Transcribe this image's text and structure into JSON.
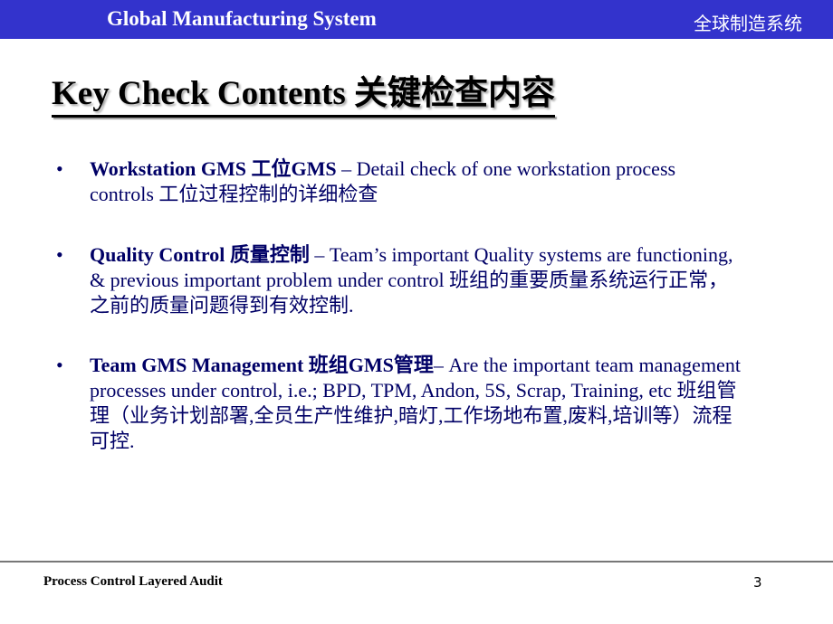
{
  "header": {
    "title": "Global Manufacturing System",
    "title_cn": "全球制造系统",
    "background_color": "#3333cc"
  },
  "slide": {
    "title": "Key Check Contents 关键检查内容",
    "bullet_symbol": "•",
    "bullets": [
      {
        "lead": "Workstation GMS 工位GMS",
        "rest": " – Detail check of one workstation process controls 工位过程控制的详细检查"
      },
      {
        "lead": "Quality Control 质量控制",
        "rest": " – Team’s important Quality systems are functioning, & previous important problem under control 班组的重要质量系统运行正常，之前的质量问题得到有效控制."
      },
      {
        "lead": "Team GMS Management 班组GMS管理",
        "rest": "– Are the important team management processes under control,  i.e.; BPD, TPM, Andon, 5S, Scrap, Training,  etc 班组管理（业务计划部署,全员生产性维护,暗灯,工作场地布置,废料,培训等）流程可控."
      }
    ],
    "text_color": "#000066"
  },
  "footer": {
    "label": "Process Control Layered Audit",
    "page_number": "3"
  }
}
